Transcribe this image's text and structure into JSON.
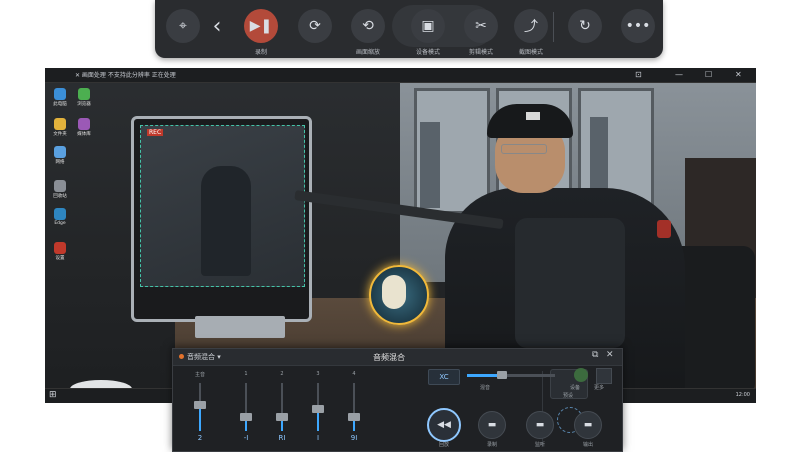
{
  "toolbar": {
    "items": [
      {
        "name": "target",
        "icon": "target-icon",
        "glyph": "⌖",
        "label": ""
      },
      {
        "name": "back",
        "icon": "chevron-left-icon",
        "glyph": "‹",
        "label": ""
      },
      {
        "name": "play-pause",
        "icon": "play-pause-icon",
        "glyph": "▶❚",
        "label": "录制",
        "active": true
      },
      {
        "name": "rotate",
        "icon": "rotate-icon",
        "glyph": "⟳",
        "label": ""
      },
      {
        "name": "scroll-mode",
        "icon": "scroll-icon",
        "glyph": "⟲",
        "label": "画面缩放"
      },
      {
        "name": "device-mode",
        "icon": "device-icon",
        "glyph": "▣",
        "label": "设备模式"
      },
      {
        "name": "cut-tool",
        "icon": "cut-icon",
        "glyph": "✂",
        "label": "剪辑模式"
      },
      {
        "name": "share-tool",
        "icon": "share-icon",
        "glyph": "⤴",
        "label": "截图模式"
      },
      {
        "name": "refresh",
        "icon": "refresh-icon",
        "glyph": "↻",
        "label": ""
      },
      {
        "name": "more",
        "icon": "more-icon",
        "glyph": "•••",
        "label": ""
      }
    ]
  },
  "desktop": {
    "window_title": "✕ 画面处理 不支持此分辨率 正在处理",
    "rec_badge": "REC",
    "icons": [
      {
        "name": "this-pc",
        "label": "此电脑",
        "color": "#3b8fd8"
      },
      {
        "name": "folder",
        "label": "文件夹",
        "color": "#e2b23c"
      },
      {
        "name": "network",
        "label": "网络",
        "color": "#5aa0e0"
      },
      {
        "name": "recycle",
        "label": "回收站",
        "color": "#8a8f96"
      },
      {
        "name": "browser",
        "label": "浏览器",
        "color": "#4caf50"
      },
      {
        "name": "media",
        "label": "媒体库",
        "color": "#9b59b6"
      },
      {
        "name": "edge",
        "label": "Edge",
        "color": "#2e86c1"
      },
      {
        "name": "settings",
        "label": "设置",
        "color": "#c0392b"
      }
    ],
    "taskbar_time": "12:00"
  },
  "mixer": {
    "source_label": "音频混合",
    "title": "音频混合",
    "channels": [
      {
        "name": "主音",
        "value": "2",
        "level": 0.55
      },
      {
        "name": "1",
        "value": "-I",
        "level": 0.3
      },
      {
        "name": "2",
        "value": "RI",
        "level": 0.3
      },
      {
        "name": "3",
        "value": "I",
        "level": 0.45
      },
      {
        "name": "4",
        "value": "9I",
        "level": 0.3
      }
    ],
    "preset_label": "预设",
    "xc_label": "XC",
    "master_label": "混音",
    "master_level": 0.4,
    "buttons": [
      {
        "name": "rewind",
        "label": "回放",
        "glyph": "◀◀"
      },
      {
        "name": "record",
        "label": "录制",
        "glyph": "▬"
      },
      {
        "name": "monitor",
        "label": "监听",
        "glyph": "▬"
      },
      {
        "name": "output",
        "label": "输出",
        "glyph": "▬"
      }
    ],
    "right_labels": [
      "设备",
      "更多"
    ],
    "accent": "#3da8ff"
  },
  "colors": {
    "active_button": "#b34a3a",
    "highlight_ring": "#f1b93a"
  }
}
